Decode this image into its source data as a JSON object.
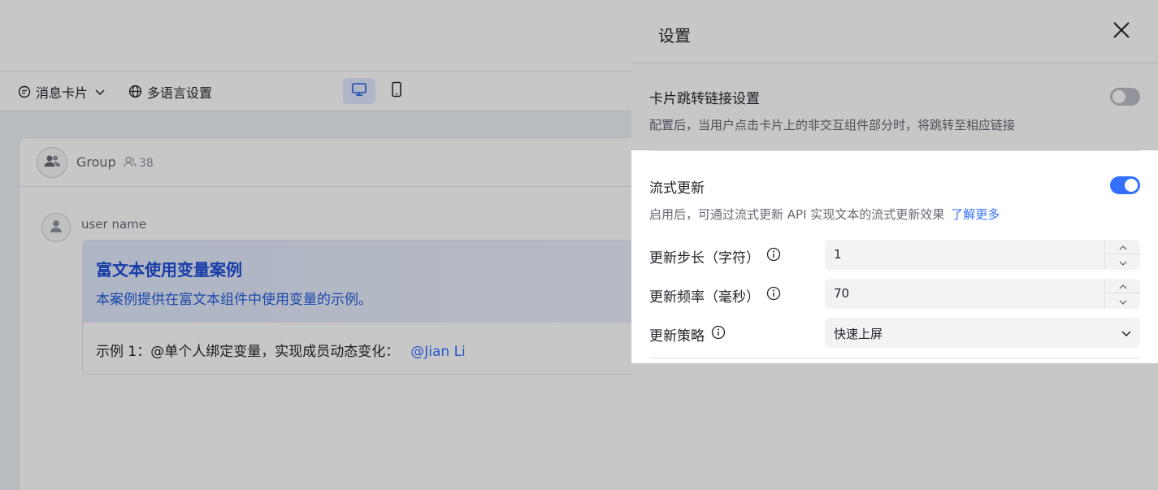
{
  "toolbar": {
    "message_card_label": "消息卡片",
    "language_label": "多语言设置"
  },
  "chat": {
    "group_name": "Group",
    "member_count": "38",
    "user_name": "user name"
  },
  "card": {
    "title": "富文本使用变量案例",
    "subtitle": "本案例提供在富文本组件中使用变量的示例。",
    "body_text": "示例 1：@单个人绑定变量，实现成员动态变化：",
    "mention": "@Jian Li"
  },
  "drawer": {
    "title": "设置",
    "link_section": {
      "title": "卡片跳转链接设置",
      "description": "配置后，当用户点击卡片上的非交互组件部分时，将跳转至相应链接",
      "enabled": false
    },
    "streaming_section": {
      "title": "流式更新",
      "description": "启用后，可通过流式更新 API 实现文本的流式更新效果",
      "learn_more": "了解更多",
      "enabled": true
    },
    "fields": {
      "step": {
        "label": "更新步长（字符）",
        "value": "1"
      },
      "frequency": {
        "label": "更新频率（毫秒）",
        "value": "70"
      },
      "strategy": {
        "label": "更新策略",
        "value": "快速上屏"
      }
    }
  },
  "colors": {
    "accent": "#3370ff",
    "toggle_off": "#bbbfc4",
    "card_title": "#1f4ed8"
  },
  "icons": [
    "message-card-icon",
    "chevron-down-icon",
    "globe-icon",
    "desktop-icon",
    "mobile-icon",
    "avatar-icon",
    "members-icon",
    "close-icon",
    "info-icon",
    "chevron-up-icon"
  ]
}
